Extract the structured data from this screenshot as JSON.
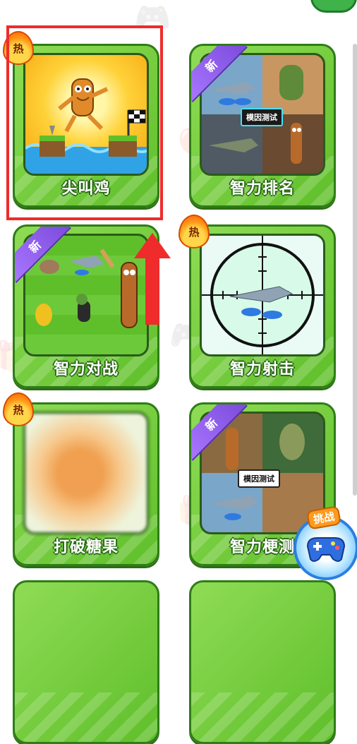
{
  "cards": [
    {
      "title": "尖叫鸡",
      "badge": "热"
    },
    {
      "title": "智力排名",
      "badge": "新",
      "overlay_label": "模因测试"
    },
    {
      "title": "智力对战",
      "badge": "新"
    },
    {
      "title": "智力射击",
      "badge": "热"
    },
    {
      "title": "打破糖果",
      "badge": "热"
    },
    {
      "title": "智力梗测",
      "badge": "新",
      "overlay_label": "模因测试"
    }
  ],
  "fab": {
    "label": "挑战",
    "icon": "gamepad-icon"
  },
  "colors": {
    "card_green": "#5fbf2a",
    "highlight_red": "#ef2b2b",
    "ribbon_purple": "#7c4bdc",
    "hot_orange": "#ff9a1a"
  }
}
